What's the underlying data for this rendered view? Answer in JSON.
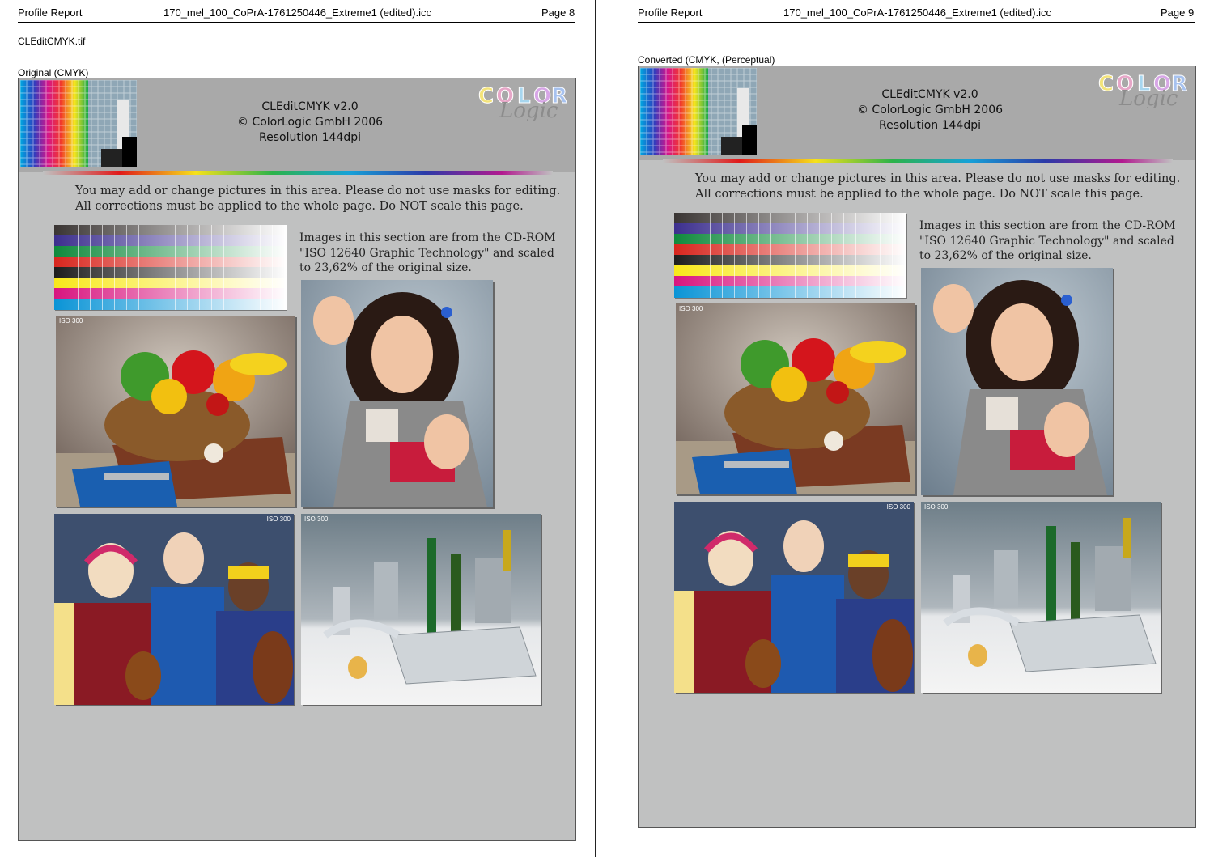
{
  "pages": [
    {
      "header": {
        "left": "Profile Report",
        "center": "170_mel_100_CoPrA-1761250446_Extreme1 (edited).icc",
        "right": "Page 8"
      },
      "file_label": "CLEditCMYK.tif",
      "section_label": "Original (CMYK)"
    },
    {
      "header": {
        "left": "Profile Report",
        "center": "170_mel_100_CoPrA-1761250446_Extreme1 (edited).icc",
        "right": "Page 9"
      },
      "section_label": "Converted (CMYK, (Perceptual)"
    }
  ],
  "canvas": {
    "title_lines": [
      "CLEditCMYK v2.0",
      "© ColorLogic GmbH 2006",
      "Resolution 144dpi"
    ],
    "logo_text": "COLOR",
    "logo_script": "Logic",
    "note_lines": [
      "You may add or change pictures in this area. Please do not use masks for editing.",
      "All corrections must be applied to the whole page. Do NOT scale this page."
    ],
    "images_text_lines": [
      "Images in this section are from the CD-ROM",
      "\"ISO 12640 Graphic Technology\" and scaled",
      "to 23,62% of the original size."
    ],
    "iso_label": "ISO 300"
  },
  "colors": {
    "canvas_bg": "#c0c1c1",
    "banner_bg": "#a9a9a9"
  }
}
